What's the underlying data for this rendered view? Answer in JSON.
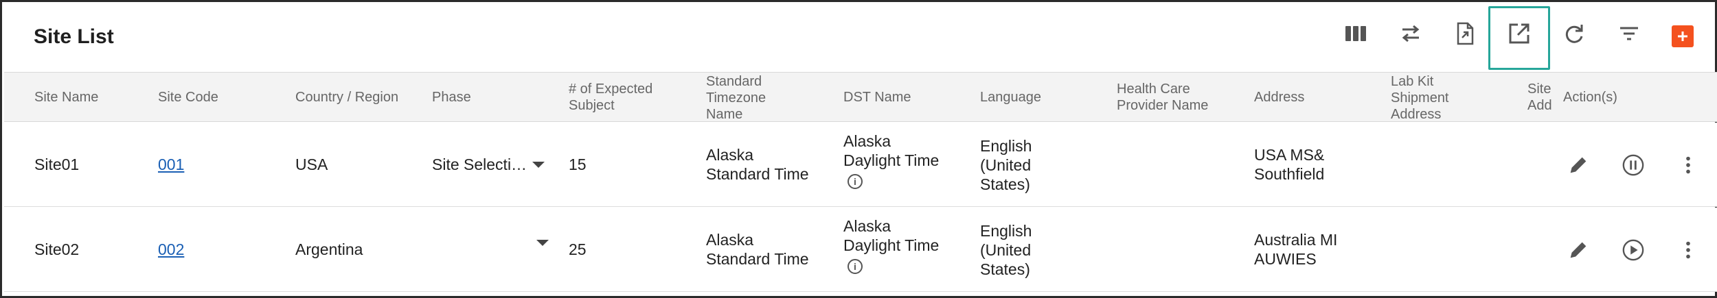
{
  "page": {
    "title": "Site List"
  },
  "toolbar": {
    "icons": [
      "columns-icon",
      "swap-icon",
      "export-file-icon",
      "open-external-icon",
      "refresh-icon",
      "filter-icon",
      "add-icon"
    ]
  },
  "table": {
    "headers": {
      "site_name": "Site Name",
      "site_code": "Site Code",
      "country": "Country / Region",
      "phase": "Phase",
      "expected_l1": "# of Expected",
      "expected_l2": "Subject",
      "tz_l1": "Standard",
      "tz_l2": "Timezone",
      "tz_l3": "Name",
      "dst": "DST Name",
      "language": "Language",
      "hcp_l1": "Health Care",
      "hcp_l2": "Provider Name",
      "address": "Address",
      "lab_l1": "Lab Kit",
      "lab_l2": "Shipment",
      "lab_l3": "Address",
      "siteadd_l1": "Site",
      "siteadd_l2": "Add",
      "actions": "Action(s)"
    },
    "rows": [
      {
        "site_name": "Site01",
        "site_code": "001",
        "country": "USA",
        "phase": "Site Selecti…",
        "expected": "15",
        "tz_l1": "Alaska",
        "tz_l2": "Standard Time",
        "dst_l1": "Alaska",
        "dst_l2": "Daylight Time",
        "lang_l1": "English",
        "lang_l2": "(United",
        "lang_l3": "States)",
        "addr_l1": "USA MS&",
        "addr_l2": "Southfield",
        "status_action": "pause"
      },
      {
        "site_name": "Site02",
        "site_code": "002",
        "country": "Argentina",
        "phase": "",
        "expected": "25",
        "tz_l1": "Alaska",
        "tz_l2": "Standard Time",
        "dst_l1": "Alaska",
        "dst_l2": "Daylight Time",
        "lang_l1": "English",
        "lang_l2": "(United",
        "lang_l3": "States)",
        "addr_l1": "Australia MI",
        "addr_l2": "AUWIES",
        "status_action": "play"
      }
    ]
  },
  "colors": {
    "accent_teal": "#26a69a",
    "add_orange": "#f4511e",
    "link_blue": "#1a5fb4"
  }
}
